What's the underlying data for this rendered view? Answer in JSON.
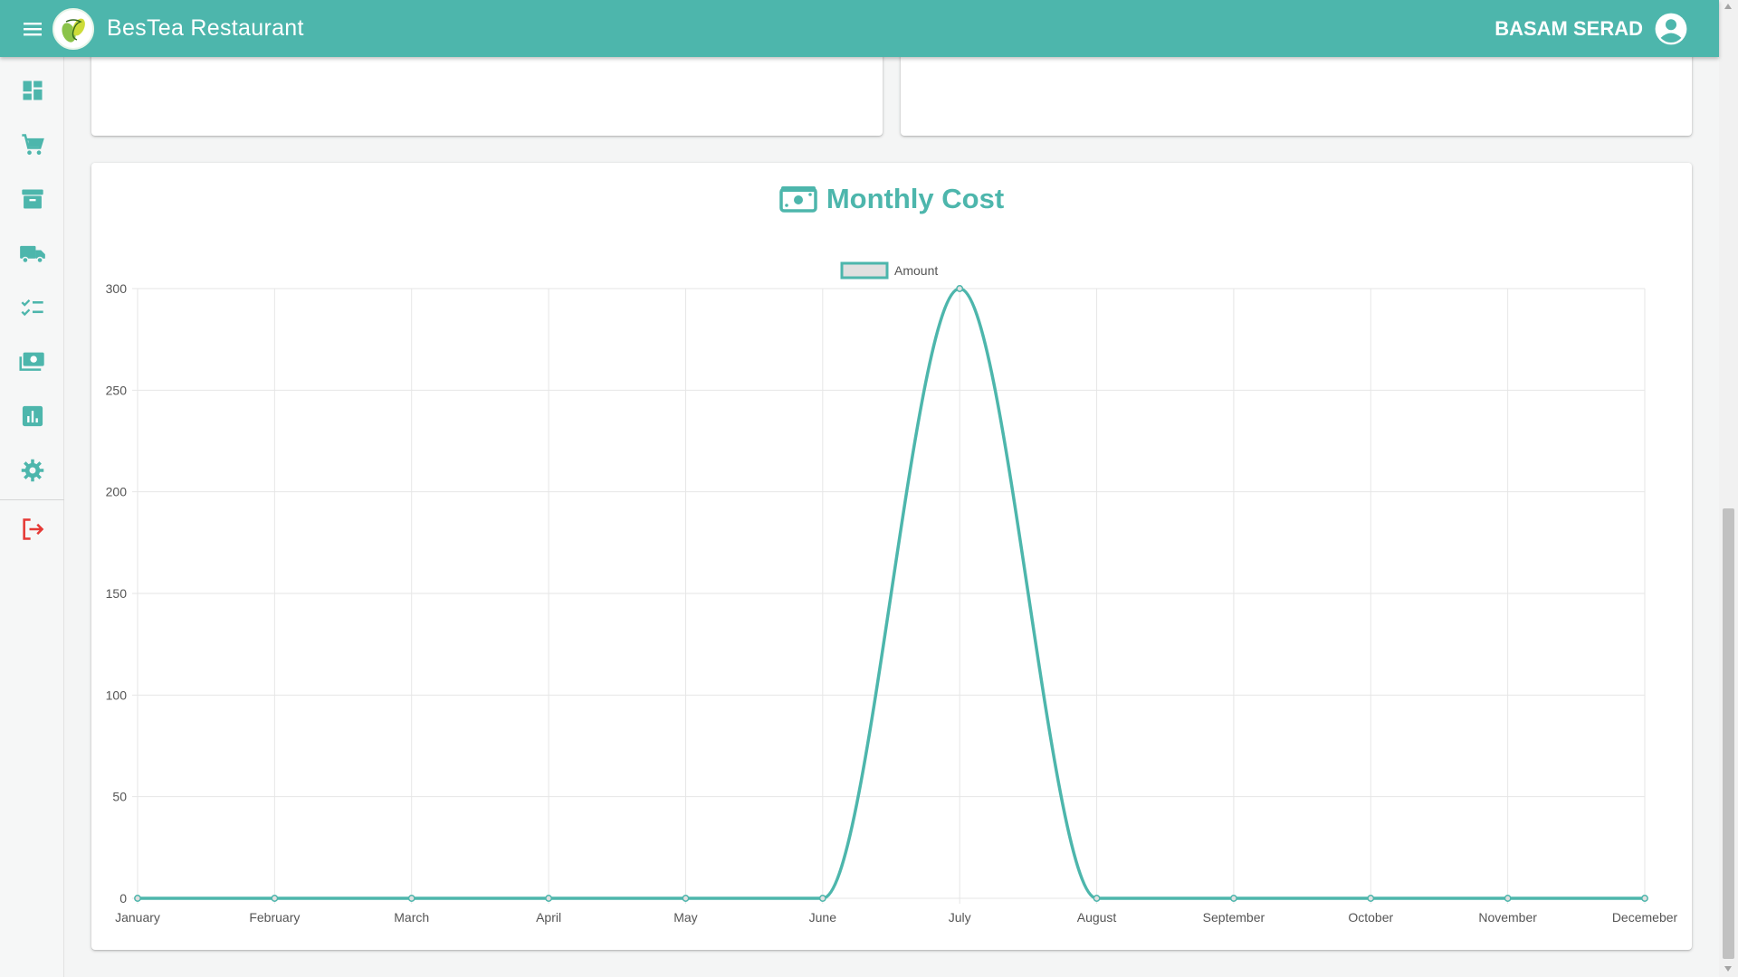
{
  "header": {
    "app_title": "BesTea Restaurant",
    "user_name": "BASAM SERAD",
    "icons": {
      "menu": "menu-icon",
      "logo": "bestea-logo",
      "account": "account-circle-icon"
    }
  },
  "sidebar": {
    "items": [
      {
        "icon": "dashboard-icon"
      },
      {
        "icon": "cart-icon"
      },
      {
        "icon": "archive-icon"
      },
      {
        "icon": "truck-icon"
      },
      {
        "icon": "checklist-icon"
      },
      {
        "icon": "money-icon"
      },
      {
        "icon": "bar-chart-icon"
      },
      {
        "icon": "settings-icon"
      },
      {
        "icon": "logout-icon"
      }
    ]
  },
  "colors": {
    "primary": "#4db6ac",
    "logout": "#e53935",
    "legend_fill": "#e0e0e0"
  },
  "chart": {
    "heading": "Monthly Cost",
    "heading_icon": "money-icon"
  },
  "chart_data": {
    "type": "line",
    "categories": [
      "January",
      "February",
      "March",
      "April",
      "May",
      "June",
      "July",
      "August",
      "September",
      "October",
      "November",
      "Decemeber"
    ],
    "series": [
      {
        "name": "Amount",
        "values": [
          0,
          0,
          0,
          0,
          0,
          0,
          300,
          0,
          0,
          0,
          0,
          0
        ]
      }
    ],
    "ylim": [
      0,
      300
    ],
    "yticks": [
      0,
      50,
      100,
      150,
      200,
      250,
      300
    ],
    "grid": true,
    "legend": "top-center",
    "smooth": true
  }
}
